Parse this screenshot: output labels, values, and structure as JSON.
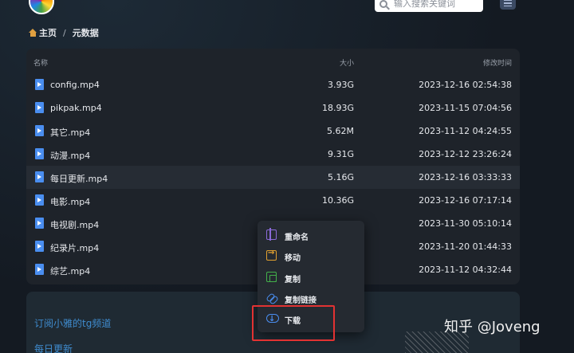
{
  "header": {
    "search_placeholder": "输入搜索关键词"
  },
  "breadcrumb": {
    "home": "主页",
    "separator": "/",
    "current": "元数据"
  },
  "table": {
    "columns": {
      "name": "名称",
      "size": "大小",
      "time": "修改时间"
    },
    "rows": [
      {
        "name": "config.mp4",
        "size": "3.93G",
        "time": "2023-12-16 02:54:38"
      },
      {
        "name": "pikpak.mp4",
        "size": "18.93G",
        "time": "2023-11-15 07:04:56"
      },
      {
        "name": "其它.mp4",
        "size": "5.62M",
        "time": "2023-11-12 04:24:55"
      },
      {
        "name": "动漫.mp4",
        "size": "9.31G",
        "time": "2023-12-12 23:26:24"
      },
      {
        "name": "每日更新.mp4",
        "size": "5.16G",
        "time": "2023-12-16 03:33:33"
      },
      {
        "name": "电影.mp4",
        "size": "10.36G",
        "time": "2023-12-16 07:17:14"
      },
      {
        "name": "电视剧.mp4",
        "size": "",
        "time": "2023-11-30 05:10:14"
      },
      {
        "name": "纪录片.mp4",
        "size": "",
        "time": "2023-11-20 01:44:33"
      },
      {
        "name": "综艺.mp4",
        "size": "",
        "time": "2023-11-12 04:32:44"
      }
    ]
  },
  "context_menu": {
    "items": [
      {
        "label": "重命名",
        "icon": "rename-icon"
      },
      {
        "label": "移动",
        "icon": "move-icon"
      },
      {
        "label": "复制",
        "icon": "copy-icon"
      },
      {
        "label": "复制链接",
        "icon": "link-icon"
      },
      {
        "label": "下载",
        "icon": "download-icon"
      }
    ]
  },
  "bottom": {
    "link1": "订阅小雅的tg频道",
    "link2": "每日更新"
  },
  "watermark": "知乎 @Joveng",
  "colors": {
    "accent": "#4a8ef0",
    "highlight_box": "#e23232",
    "link": "#3f8ccf"
  }
}
